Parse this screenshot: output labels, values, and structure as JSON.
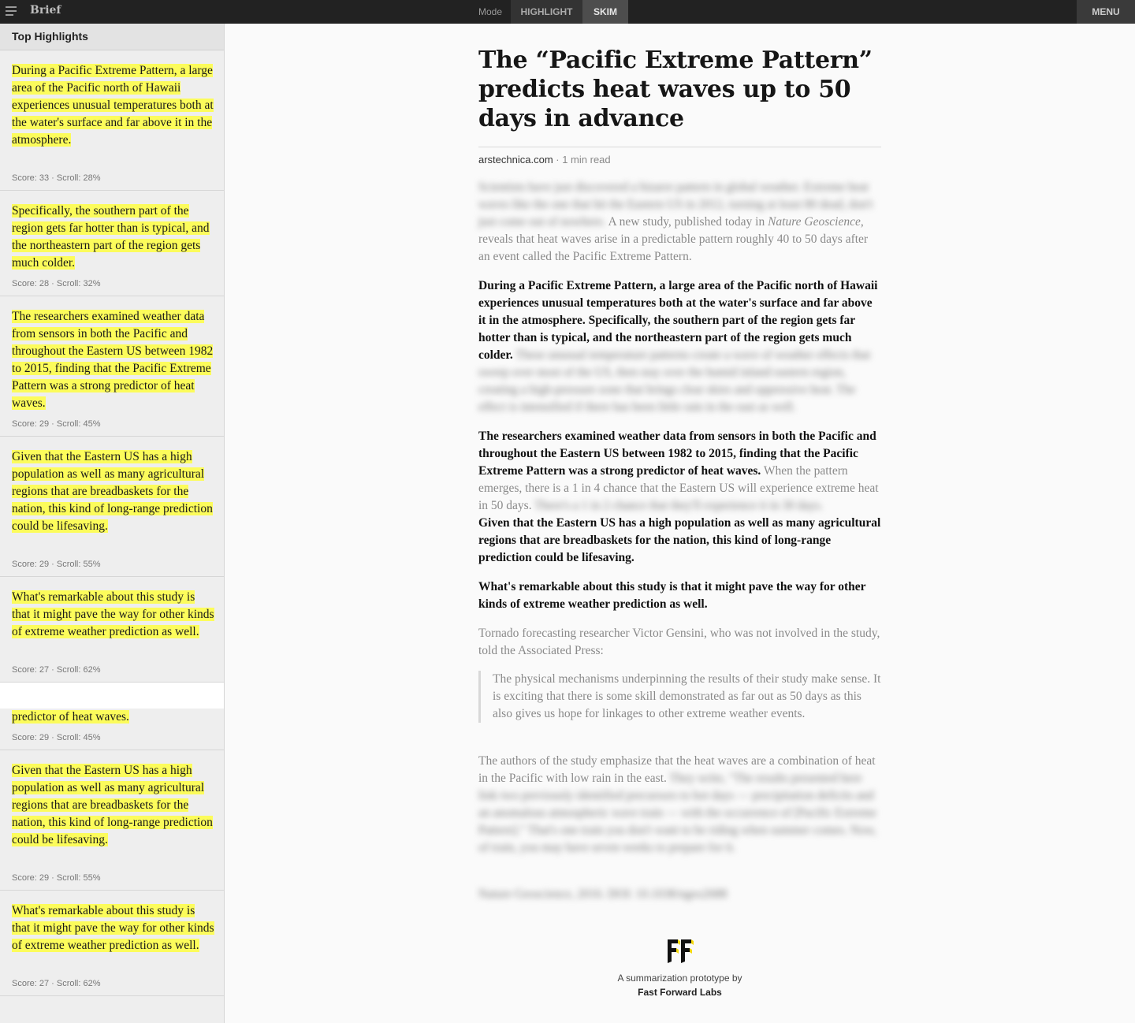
{
  "topbar": {
    "brand": "Brief",
    "mode_label": "Mode",
    "mode_highlight": "HIGHLIGHT",
    "mode_skim": "SKIM",
    "menu": "MENU"
  },
  "sidebar": {
    "header": "Top Highlights",
    "items": [
      {
        "text": "During a Pacific Extreme Pattern, a large area of the Pacific north of Hawaii experiences unusual temperatures both at the water's surface and far above it in the atmosphere.",
        "meta": "Score: 33 · Scroll: 28%"
      },
      {
        "text": "Specifically, the southern part of the region gets far hotter than is typical, and the northeastern part of the region gets much colder.",
        "meta": "Score: 28 · Scroll: 32%"
      },
      {
        "text": "The researchers examined weather data from sensors in both the Pacific and throughout the Eastern US between 1982 to 2015, finding that the Pacific Extreme Pattern was a strong predictor of heat waves.",
        "meta": "Score: 29 · Scroll: 45%"
      },
      {
        "text": "Given that the Eastern US has a high population as well as many agricultural regions that are breadbaskets for the nation, this kind of long-range prediction could be lifesaving.",
        "meta": "Score: 29 · Scroll: 55%"
      },
      {
        "text": "What's remarkable about this study is that it might pave the way for other kinds of extreme weather prediction as well.",
        "meta": "Score: 27 · Scroll: 62%"
      },
      {
        "text": "predictor of heat waves.",
        "meta": "Score: 29 · Scroll: 45%"
      },
      {
        "text": "Given that the Eastern US has a high population as well as many agricultural regions that are breadbaskets for the nation, this kind of long-range prediction could be lifesaving.",
        "meta": "Score: 29 · Scroll: 55%"
      },
      {
        "text": "What's remarkable about this study is that it might pave the way for other kinds of extreme weather prediction as well.",
        "meta": "Score: 27 · Scroll: 62%"
      }
    ]
  },
  "article": {
    "title": "The “Pacific Extreme Pattern” predicts heat waves up to 50 days in advance",
    "source": "arstechnica.com",
    "read_time": " · 1 min read",
    "p1_blur": "Scientists have just discovered a bizarre pattern in global weather. Extreme heat waves like the one that hit the Eastern US in 2012, turning at least 80 dead, don't just come out of nowhere.",
    "p1_visible_a": " A new study, published today in ",
    "p1_italic": "Nature Geoscience",
    "p1_visible_b": ", reveals that heat waves arise in a predictable pattern roughly 40 to 50 days after an event called the Pacific Extreme Pattern.",
    "p2_strong": "During a Pacific Extreme Pattern, a large area of the Pacific north of Hawaii experiences unusual temperatures both at the water's surface and far above it in the atmosphere. Specifically, the southern part of the region gets far hotter than is typical, and the northeastern part of the region gets much colder.",
    "p2_blur": " These unusual temperature patterns create a wave of weather effects that sweep over most of the US, then stay over the humid inland eastern region, creating a high-pressure zone that brings clear skies and oppressive heat. The effect is intensified if there has been little rain in the east as well.",
    "p3_strong": "The researchers examined weather data from sensors in both the Pacific and throughout the Eastern US between 1982 to 2015, finding that the Pacific Extreme Pattern was a strong predictor of heat waves.",
    "p3_faded": " When the pattern emerges, there is a 1 in 4 chance that the Eastern US will experience extreme heat in 50 days.",
    "p3_blur": " There's a 1 in 2 chance that they'll experience it in 30 days.",
    "p4_strong": "Given that the Eastern US has a high population as well as many agricultural regions that are breadbaskets for the nation, this kind of long-range prediction could be lifesaving.",
    "p5_strong": "What's remarkable about this study is that it might pave the way for other kinds of extreme weather prediction as well.",
    "p6": "Tornado forecasting researcher Victor Gensini, who was not involved in the study, told the Associated Press:",
    "quote": "The physical mechanisms underpinning the results of their study make sense. It is exciting that there is some skill demonstrated as far out as 50 days as this also gives us hope for linkages to other extreme weather events.",
    "p7_visible": "The authors of the study emphasize that the heat waves are a combination of heat in the Pacific with low rain in the east.",
    "p7_blur": " They write, \"The results presented here link two previously identified precursors to hot days — precipitation deficits and an anomalous atmospheric wave train — with the occurrence of [Pacific Extreme Pattern].\" That's one train you don't want to be riding when summer comes. Now, of train, you may have seven weeks to prepare for it.",
    "citation_blur": "Nature Geoscience, 2016. DOI: 10.1038/ngeo2688"
  },
  "footer": {
    "line1": "A summarization prototype by",
    "line2": "Fast Forward Labs"
  },
  "colors": {
    "highlight": "#fcfc5b",
    "topbar": "#222222",
    "logo_accent": "#f5d90a"
  }
}
